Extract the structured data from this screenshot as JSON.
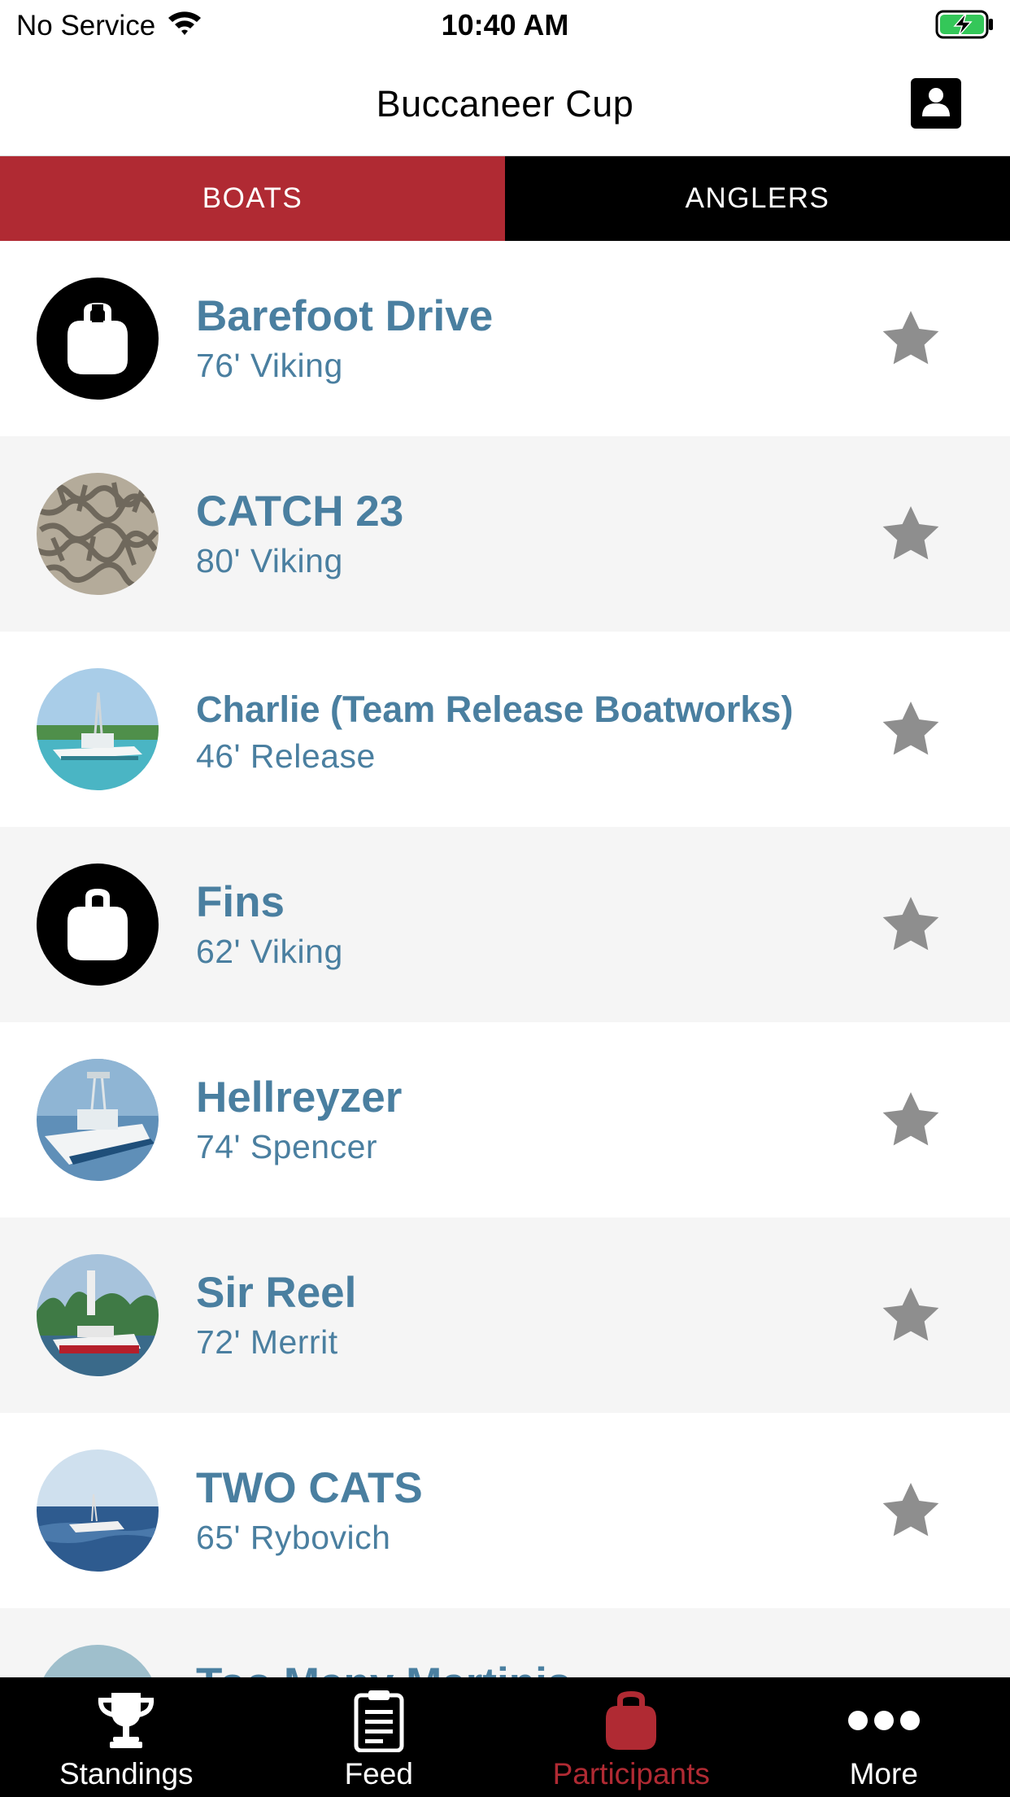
{
  "status_bar": {
    "carrier": "No Service",
    "time": "10:40 AM",
    "battery_color": "#34c759"
  },
  "header": {
    "title": "Buccaneer Cup",
    "profile_icon": "person-card-icon"
  },
  "tabs": [
    {
      "label": "BOATS",
      "active": true
    },
    {
      "label": "ANGLERS",
      "active": false
    }
  ],
  "boats": [
    {
      "name": "Barefoot Drive",
      "subtitle": "76' Viking",
      "avatar": "placeholder-boat-icon"
    },
    {
      "name": "CATCH 23",
      "subtitle": "80' Viking",
      "avatar": "camouflage-pattern-photo"
    },
    {
      "name": "Charlie (Team Release Boatworks)",
      "subtitle": "46' Release",
      "avatar": "boat-photo"
    },
    {
      "name": "Fins",
      "subtitle": "62' Viking",
      "avatar": "placeholder-boat-icon"
    },
    {
      "name": "Hellreyzer",
      "subtitle": "74' Spencer",
      "avatar": "boat-photo"
    },
    {
      "name": "Sir Reel",
      "subtitle": "72' Merrit",
      "avatar": "boat-photo"
    },
    {
      "name": "TWO CATS",
      "subtitle": "65' Rybovich",
      "avatar": "boat-photo"
    },
    {
      "name": "Too Many Martinis",
      "subtitle": "",
      "avatar": "boat-photo"
    }
  ],
  "bottom_tabs": [
    {
      "label": "Standings",
      "icon": "trophy-icon",
      "active": false
    },
    {
      "label": "Feed",
      "icon": "clipboard-icon",
      "active": false
    },
    {
      "label": "Participants",
      "icon": "boat-bow-icon",
      "active": true
    },
    {
      "label": "More",
      "icon": "ellipsis-icon",
      "active": false
    }
  ],
  "colors": {
    "accent": "#b02a33",
    "name_text": "#4a7fa0",
    "star": "#8e8e8e",
    "row_alt": "#f5f5f5"
  }
}
